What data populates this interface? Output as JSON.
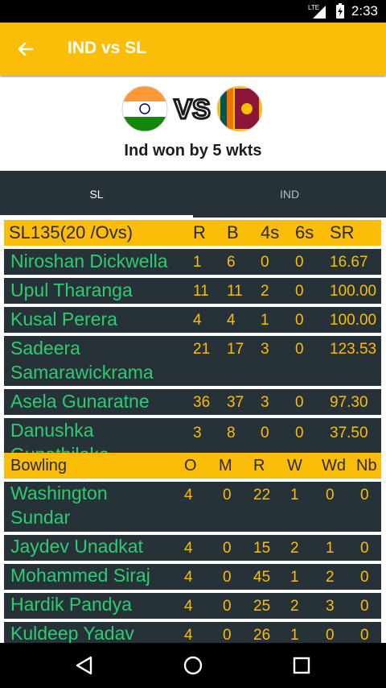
{
  "status_bar": {
    "time": "2:33",
    "network": "LTE"
  },
  "app_bar": {
    "title": "IND vs SL"
  },
  "match": {
    "team_a_flag": "india-flag-icon",
    "vs_label": "VS",
    "team_b_flag": "sri-lanka-flag-icon",
    "result": "Ind won by 5 wkts"
  },
  "tabs": [
    {
      "label": "SL",
      "selected": true
    },
    {
      "label": "IND",
      "selected": false
    }
  ],
  "batting": {
    "header": {
      "team": "SL135(20 /Ovs)",
      "r": "R",
      "b": "B",
      "fours": "4s",
      "sixes": "6s",
      "sr": "SR"
    },
    "rows": [
      {
        "name": "Niroshan Dickwella",
        "r": "1",
        "b": "6",
        "fours": "0",
        "sixes": "0",
        "sr": "16.67"
      },
      {
        "name": "Upul Tharanga",
        "r": "11",
        "b": "11",
        "fours": "2",
        "sixes": "0",
        "sr": "100.00"
      },
      {
        "name": "Kusal Perera",
        "r": "4",
        "b": "4",
        "fours": "1",
        "sixes": "0",
        "sr": "100.00"
      },
      {
        "name1": "Sadeera",
        "name2": "Samarawickrama",
        "r": "21",
        "b": "17",
        "fours": "3",
        "sixes": "0",
        "sr": "123.53"
      },
      {
        "name": "Asela Gunaratne",
        "r": "36",
        "b": "37",
        "fours": "3",
        "sixes": "0",
        "sr": "97.30"
      },
      {
        "name1": "Danushka",
        "name2": "Gunathilaka",
        "r": "3",
        "b": "8",
        "fours": "0",
        "sixes": "0",
        "sr": "37.50"
      }
    ]
  },
  "bowling": {
    "header": {
      "label": "Bowling",
      "o": "O",
      "m": "M",
      "r": "R",
      "w": "W",
      "wd": "Wd",
      "nb": "Nb"
    },
    "rows": [
      {
        "name1": "Washington",
        "name2": "Sundar",
        "o": "4",
        "m": "0",
        "r": "22",
        "w": "1",
        "wd": "0",
        "nb": "0"
      },
      {
        "name": "Jaydev Unadkat",
        "o": "4",
        "m": "0",
        "r": "15",
        "w": "2",
        "wd": "1",
        "nb": "0"
      },
      {
        "name": "Mohammed Siraj",
        "o": "4",
        "m": "0",
        "r": "45",
        "w": "1",
        "wd": "2",
        "nb": "0"
      },
      {
        "name": "Hardik Pandya",
        "o": "4",
        "m": "0",
        "r": "25",
        "w": "2",
        "wd": "3",
        "nb": "0"
      },
      {
        "name": "Kuldeep Yadav",
        "o": "4",
        "m": "0",
        "r": "26",
        "w": "1",
        "wd": "0",
        "nb": "0"
      }
    ]
  },
  "colors": {
    "accent": "#fbbd08",
    "panel": "#263238",
    "name_text": "#2ecc71"
  },
  "nav": {
    "back": "back-triangle-icon",
    "home": "home-circle-icon",
    "recents": "recents-square-icon"
  }
}
